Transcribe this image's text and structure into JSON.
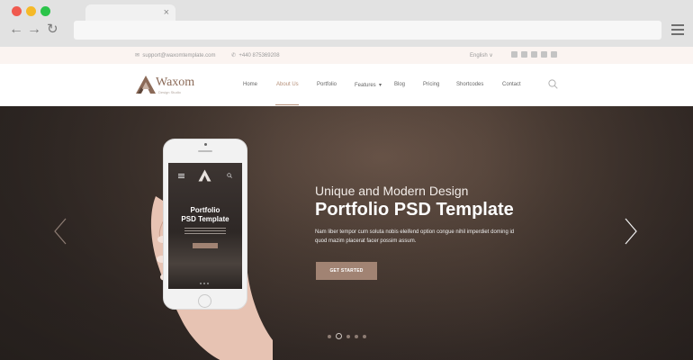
{
  "topbar": {
    "email": "support@waxomtemplate.com",
    "phone": "+440 875369208",
    "language": "English",
    "language_caret": "∨",
    "socials": [
      "facebook-icon",
      "twitter-icon",
      "google-plus-icon",
      "instagram-icon",
      "vimeo-icon"
    ]
  },
  "header": {
    "logo_name": "Waxom",
    "logo_tagline": "Design Studio",
    "nav": [
      {
        "label": "Home"
      },
      {
        "label": "About Us"
      },
      {
        "label": "Portfolio"
      },
      {
        "label": "Features"
      },
      {
        "label": "Blog"
      },
      {
        "label": "Pricing"
      },
      {
        "label": "Shortcodes"
      },
      {
        "label": "Contact"
      }
    ],
    "active_nav": "About Us",
    "features_caret": "▾"
  },
  "hero": {
    "subtitle": "Unique and Modern Design",
    "title": "Portfolio PSD Template",
    "text": "Nam liber tempor cum soluta nobis eleifend option congue nihil imperdiet doming id quod mazim placerat facer possim assum.",
    "button": "GET STARTED",
    "slide_count": 5,
    "active_slide": 2
  },
  "phone_screen": {
    "title_line1": "Portfolio",
    "title_line2": "PSD Template"
  },
  "browser": {
    "tab_close": "×",
    "back": "←",
    "forward": "→",
    "reload": "↻"
  },
  "colors": {
    "accent": "#b58f78",
    "button": "#a18373",
    "chrome": "#e2e2e2"
  }
}
